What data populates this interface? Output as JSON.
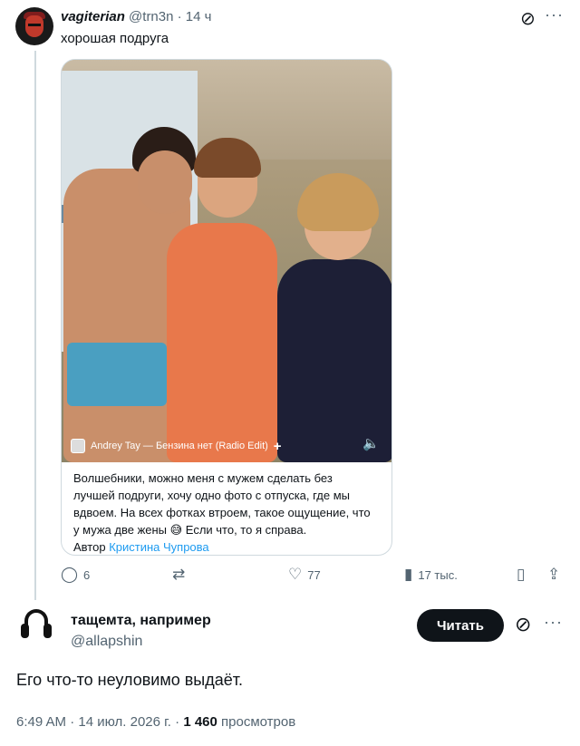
{
  "quoted_tweet": {
    "username": "vagiterian",
    "handle": "@trn3n",
    "time": "· 14 ч",
    "text": "хорошая подруга",
    "media": {
      "music_label": "Andrey Tay — Бензина нет (Radio Edit)",
      "music_plus": "+",
      "caption": "Волшебники, можно меня с мужем сделать без лучшей подруги, хочу одно фото с отпуска, где мы вдвоем. На всех фотках втроем, такое ощущение, что у мужа две жены 😅 Если что, то я справа.",
      "author_prefix": "Автор",
      "author_name": "Кристина Чупрова"
    },
    "actions": {
      "replies": "6",
      "reposts": "",
      "likes": "77",
      "views": "17 тыс."
    },
    "icons": {
      "grok": "grok-icon",
      "more": "more-icon",
      "reply": "reply-icon",
      "repost": "repost-icon",
      "like": "heart-icon",
      "views": "views-icon",
      "bookmark": "bookmark-icon",
      "share": "share-icon"
    }
  },
  "main_tweet": {
    "display_name": "тащемта, например",
    "handle": "@allapshin",
    "follow_button": "Читать",
    "text": "Его что-то неуловимо выдаёт.",
    "time": "6:49 AM",
    "date": "· 14 июл. 2026 г. ·",
    "views_count": "1 460",
    "views_label": "просмотров"
  },
  "colors": {
    "text": "#0f1419",
    "secondary": "#536471",
    "link": "#1d9bf0",
    "border": "#cfd9de",
    "button_bg": "#0f1419"
  }
}
